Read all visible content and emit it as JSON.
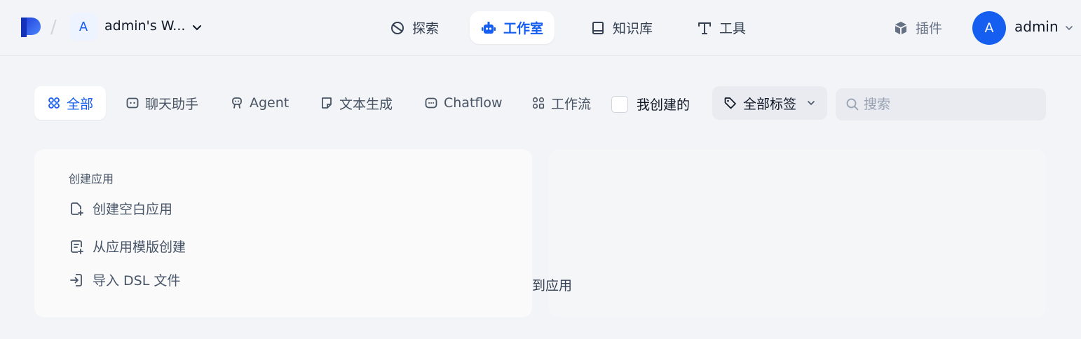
{
  "header": {
    "workspace": {
      "avatar_letter": "A",
      "name": "admin's W..."
    },
    "nav": [
      {
        "label": "探索",
        "icon": "explore-icon"
      },
      {
        "label": "工作室",
        "icon": "robot-icon",
        "active": true
      },
      {
        "label": "知识库",
        "icon": "book-icon"
      },
      {
        "label": "工具",
        "icon": "tool-icon"
      }
    ],
    "plugins_label": "插件",
    "user": {
      "avatar_letter": "A",
      "name": "admin"
    },
    "accent_color": "#155eef"
  },
  "filters": {
    "tabs": [
      {
        "label": "全部",
        "icon": "grid-icon",
        "active": true
      },
      {
        "label": "聊天助手",
        "icon": "chat-bot-icon"
      },
      {
        "label": "Agent",
        "icon": "agent-icon"
      },
      {
        "label": "文本生成",
        "icon": "note-icon"
      },
      {
        "label": "Chatflow",
        "icon": "chatflow-icon"
      },
      {
        "label": "工作流",
        "icon": "workflow-icon"
      }
    ],
    "created_by_me_label": "我创建的",
    "created_by_me_checked": false,
    "tags_label": "全部标签",
    "search_placeholder": "搜索",
    "search_value": ""
  },
  "create_card": {
    "heading": "创建应用",
    "items": [
      {
        "label": "创建空白应用",
        "icon": "file-plus-icon"
      },
      {
        "label": "从应用模版创建",
        "icon": "template-icon"
      },
      {
        "label": "导入 DSL 文件",
        "icon": "import-icon"
      }
    ]
  },
  "ghost_card": {
    "text": "到应用"
  }
}
